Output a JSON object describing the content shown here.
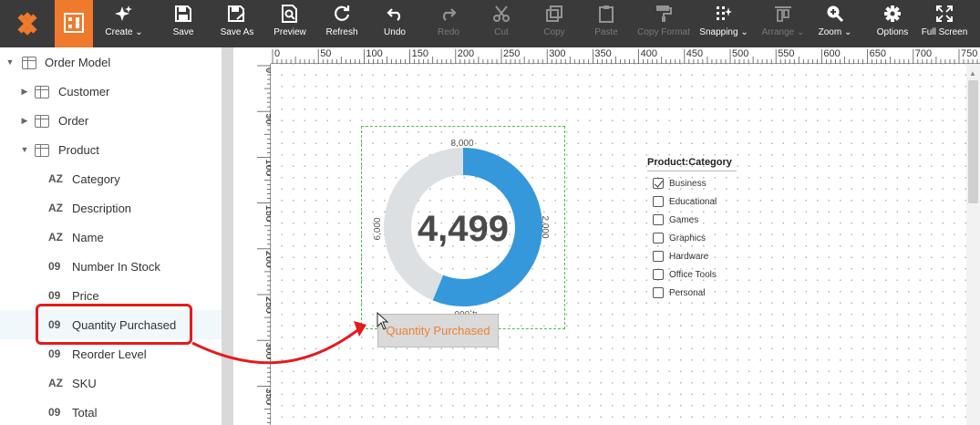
{
  "toolbar": {
    "buttons": [
      {
        "label": "Create",
        "icon": "sparkle-icon",
        "dropdown": true
      },
      {
        "label": "Save",
        "icon": "save-icon"
      },
      {
        "label": "Save As",
        "icon": "save-as-icon"
      },
      {
        "label": "Preview",
        "icon": "preview-icon"
      },
      {
        "label": "Refresh",
        "icon": "refresh-icon"
      },
      {
        "label": "Undo",
        "icon": "undo-icon"
      },
      {
        "label": "Redo",
        "icon": "redo-icon",
        "disabled": true
      },
      {
        "label": "Cut",
        "icon": "cut-icon",
        "disabled": true
      },
      {
        "label": "Copy",
        "icon": "copy-icon",
        "disabled": true
      },
      {
        "label": "Paste",
        "icon": "paste-icon",
        "disabled": true
      },
      {
        "label": "Copy Format",
        "icon": "copy-format-icon",
        "disabled": true
      },
      {
        "label": "Snapping",
        "icon": "snapping-icon",
        "dropdown": true
      },
      {
        "label": "Arrange",
        "icon": "arrange-icon",
        "dropdown": true,
        "disabled": true
      },
      {
        "label": "Zoom",
        "icon": "zoom-icon",
        "dropdown": true
      },
      {
        "label": "Options",
        "icon": "gear-icon"
      },
      {
        "label": "Full Screen",
        "icon": "full-screen-icon"
      }
    ]
  },
  "tree": {
    "root": "Order Model",
    "tables": [
      "Customer",
      "Order",
      "Product"
    ],
    "product_fields": [
      {
        "type": "AZ",
        "name": "Category"
      },
      {
        "type": "AZ",
        "name": "Description"
      },
      {
        "type": "AZ",
        "name": "Name"
      },
      {
        "type": "09",
        "name": "Number In Stock"
      },
      {
        "type": "09",
        "name": "Price"
      },
      {
        "type": "09",
        "name": "Quantity Purchased"
      },
      {
        "type": "09",
        "name": "Reorder Level"
      },
      {
        "type": "AZ",
        "name": "SKU"
      },
      {
        "type": "09",
        "name": "Total"
      }
    ]
  },
  "ruler": {
    "top": [
      "0",
      "50",
      "100",
      "150",
      "200",
      "250",
      "300",
      "350",
      "400",
      "450",
      "500",
      "550",
      "600",
      "650",
      "700",
      "750"
    ],
    "left": [
      "0",
      "50",
      "100",
      "150",
      "200",
      "250",
      "300",
      "350"
    ]
  },
  "gauge": {
    "value_label": "4,499",
    "value": 4499,
    "max": 8000,
    "tick_labels": {
      "top": "8,000",
      "right": "2,000",
      "bottom": "4,000",
      "left": "6,000"
    },
    "fill_color": "#3498db",
    "track_color": "#dde0e3"
  },
  "drag_label": "Quantity Purchased",
  "filter": {
    "title": "Product:Category",
    "items": [
      {
        "label": "Business",
        "checked": true
      },
      {
        "label": "Educational",
        "checked": false
      },
      {
        "label": "Games",
        "checked": false
      },
      {
        "label": "Graphics",
        "checked": false
      },
      {
        "label": "Hardware",
        "checked": false
      },
      {
        "label": "Office Tools",
        "checked": false
      },
      {
        "label": "Personal",
        "checked": false
      }
    ]
  },
  "colors": {
    "brand_orange": "#ef7a2b",
    "annotation_red": "#e31c1c",
    "toolbar_bg": "#3a3a3a"
  }
}
